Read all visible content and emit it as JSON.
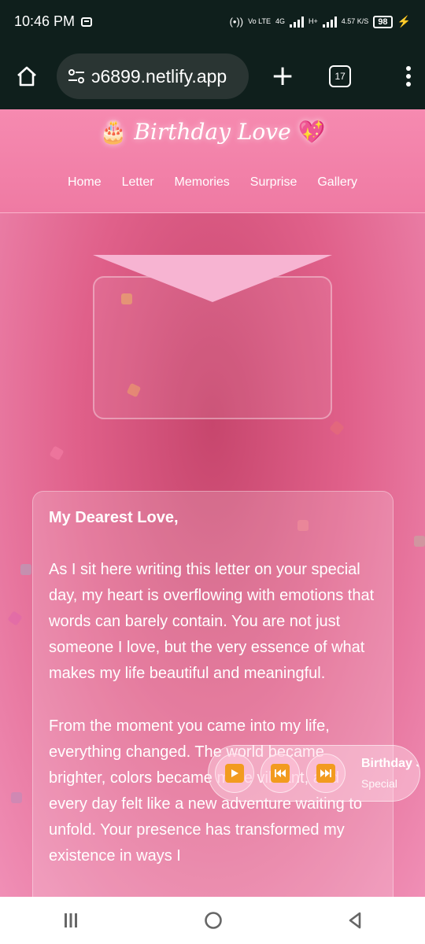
{
  "status": {
    "time": "10:46 PM",
    "hotspot": "(•))",
    "volte": "Vo LTE",
    "net1": "4G",
    "net2": "H+",
    "speed": "4.57 K/S",
    "battery": "98"
  },
  "browser": {
    "url": "ɔ6899.netlify.app",
    "tab_count": "17"
  },
  "site": {
    "brand_left_emoji": "🎂",
    "brand": "Birthday Love",
    "brand_right_emoji": "💖",
    "nav": [
      "Home",
      "Letter",
      "Memories",
      "Surprise",
      "Gallery"
    ]
  },
  "letter": {
    "greeting": "My Dearest Love,",
    "paragraphs": [
      "As I sit here writing this letter on your special day, my heart is overflowing with emotions that words can barely contain. You are not just someone I love, but the very essence of what makes my life beautiful and meaningful.",
      "From the moment you came into my life, everything changed. The world became brighter, colors became more vibrant, and every day felt like a new adventure waiting to unfold. Your presence has transformed my existence in ways I"
    ]
  },
  "player": {
    "title": "Birthday Song",
    "subtitle": "Special"
  },
  "colors": {
    "accent": "#f29b1f",
    "header": "#f68ab0",
    "page": "#e0608a"
  }
}
